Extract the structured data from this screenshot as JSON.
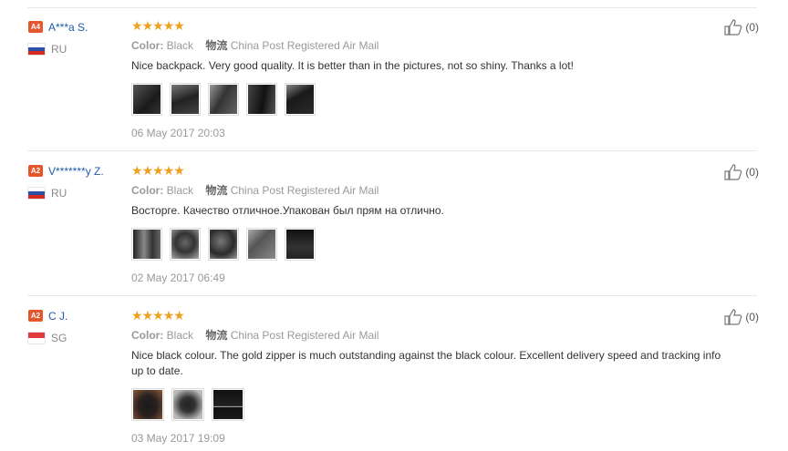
{
  "reviews": [
    {
      "level": "A4",
      "name": "A***a S.",
      "country": "RU",
      "rating": 5,
      "color_label": "Color:",
      "color_value": "Black",
      "shipping_label": "物流",
      "shipping_value": "China Post Registered Air Mail",
      "text": "Nice backpack. Very good quality. It is better than in the pictures, not so shiny. Thanks a lot!",
      "photos": [
        "#2a2a2a",
        "#3a3a3a",
        "#4a4a4a",
        "#2e2e2e",
        "#1e1e1e"
      ],
      "date": "06 May 2017 20:03",
      "helpful": "(0)"
    },
    {
      "level": "A2",
      "name": "V*******y Z.",
      "country": "RU",
      "rating": 5,
      "color_label": "Color:",
      "color_value": "Black",
      "shipping_label": "物流",
      "shipping_value": "China Post Registered Air Mail",
      "text": "Восторге. Качество отличное.Упакован был прям на отлично.",
      "photos": [
        "#3a3a3a",
        "#555555",
        "#444444",
        "#666666",
        "#222222"
      ],
      "date": "02 May 2017 06:49",
      "helpful": "(0)"
    },
    {
      "level": "A2",
      "name": "C J.",
      "country": "SG",
      "rating": 5,
      "color_label": "Color:",
      "color_value": "Black",
      "shipping_label": "物流",
      "shipping_value": "China Post Registered Air Mail",
      "text": "Nice black colour. The gold zipper is much outstanding against the black colour. Excellent delivery speed and tracking info up to date.",
      "photos": [
        "#5a3a2a",
        "#8a8a8a",
        "#1a1a1a"
      ],
      "date": "03 May 2017 19:09",
      "helpful": "(0)"
    }
  ],
  "colors": {
    "accent": "#1f5bab",
    "star": "#f0a020",
    "level_badge": "#e5562d"
  },
  "icons": {
    "helpful": "thumbs-up-icon",
    "star": "star-icon"
  }
}
